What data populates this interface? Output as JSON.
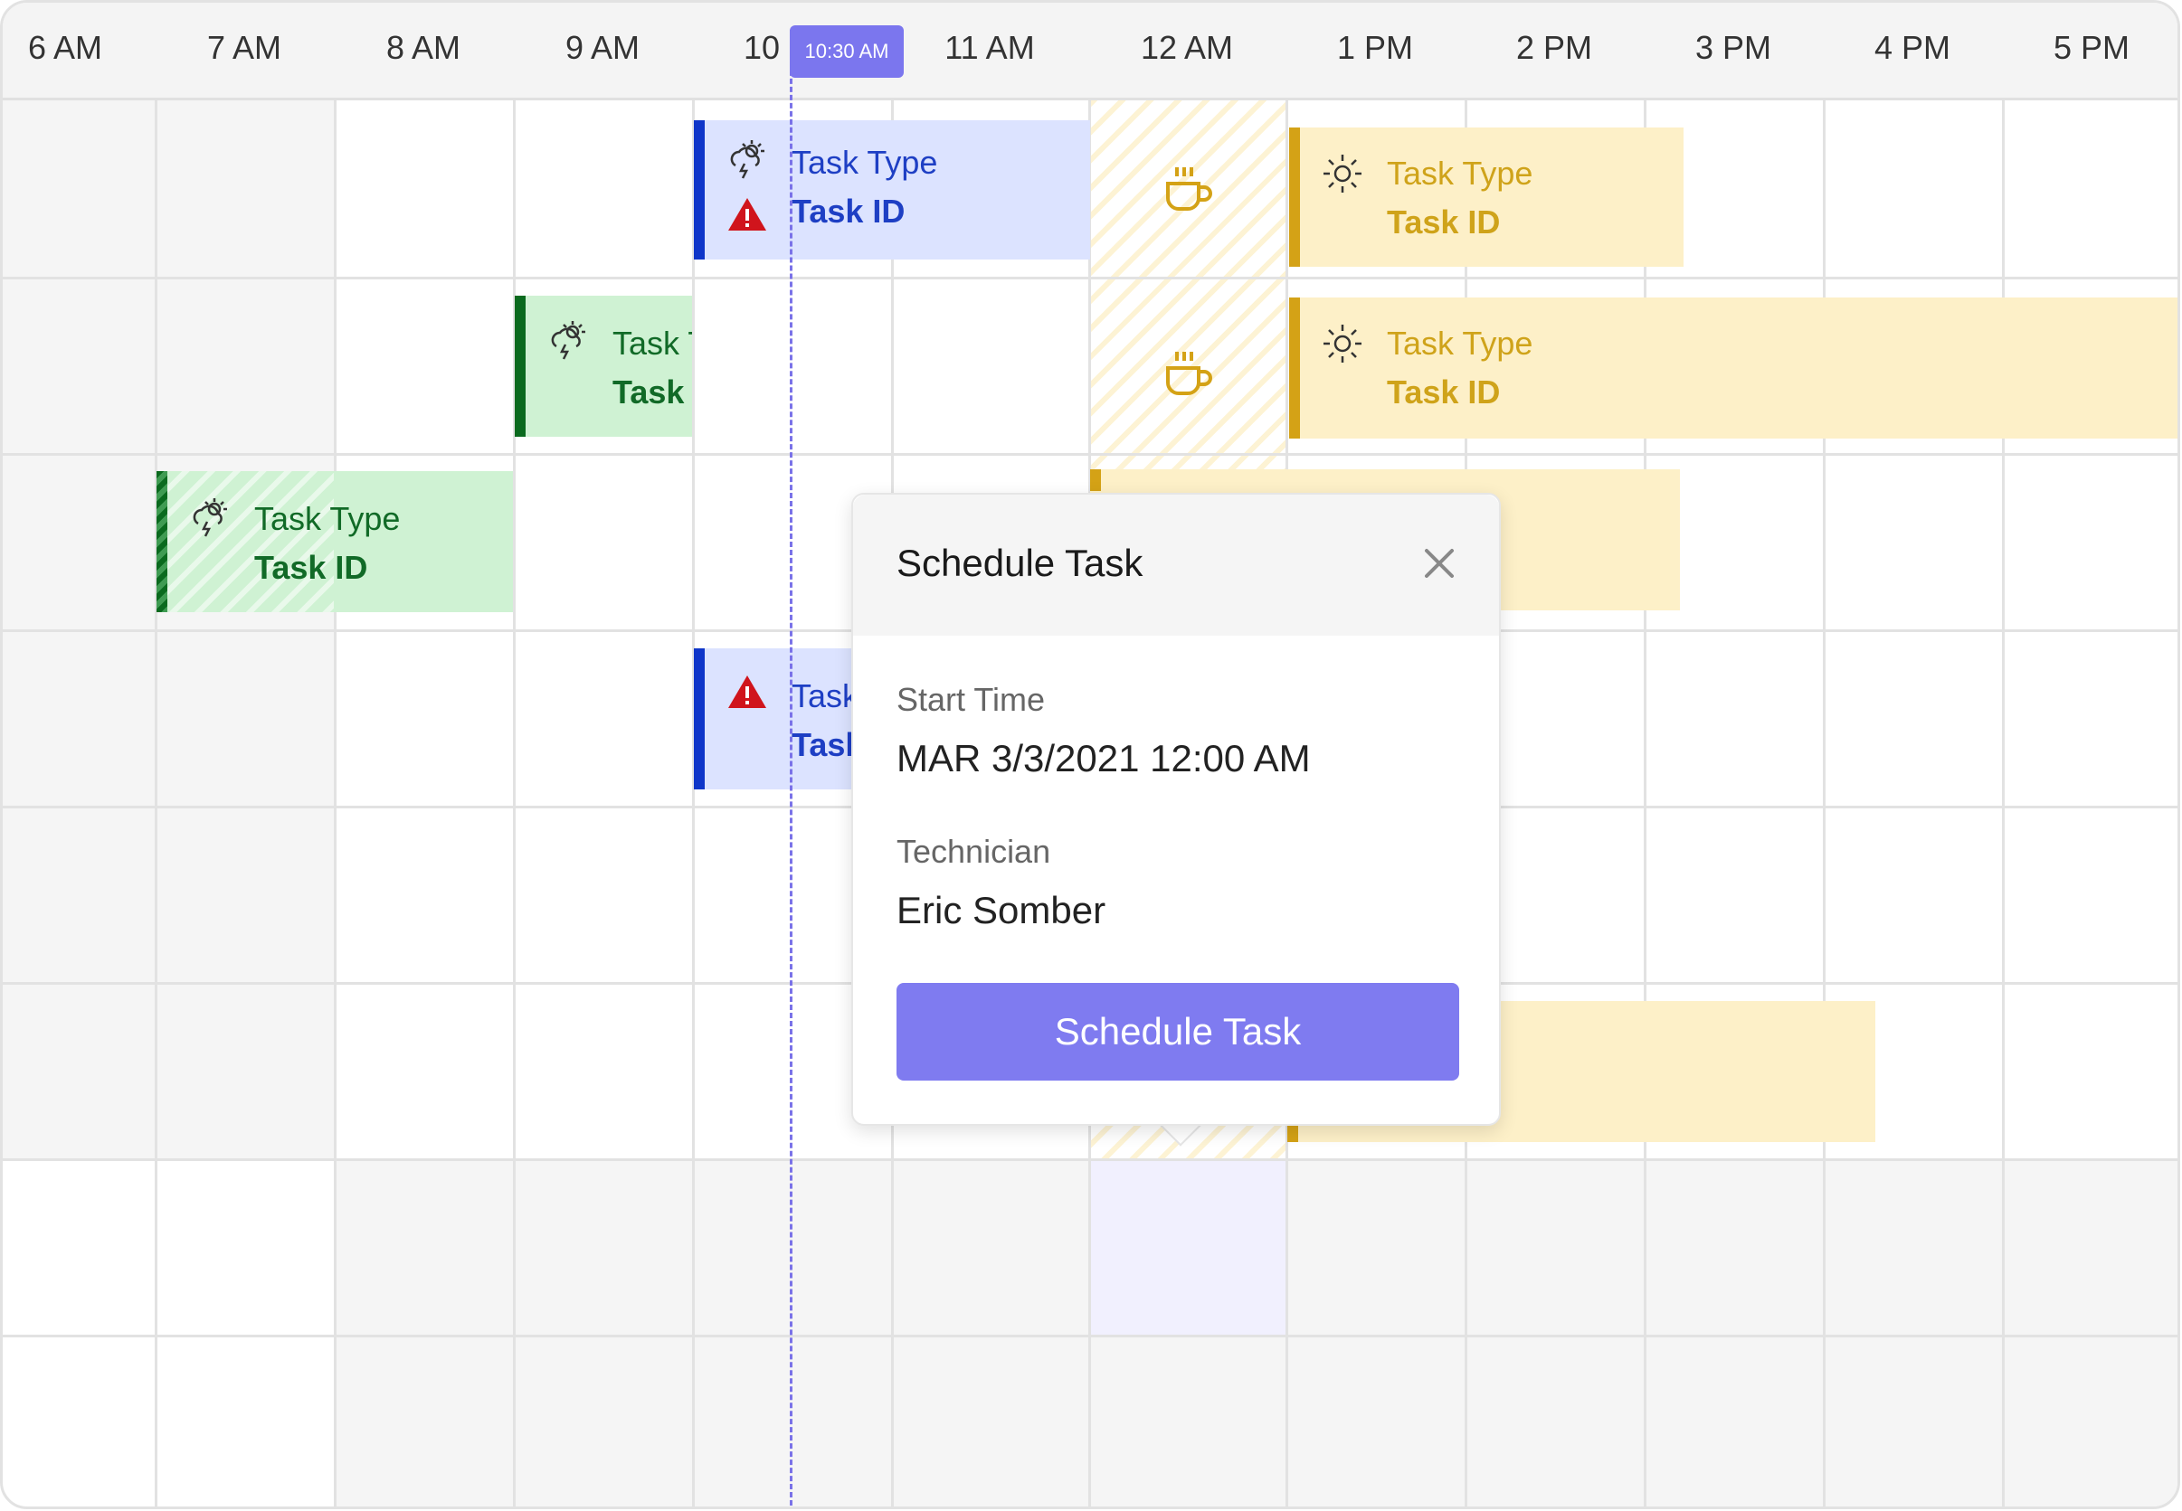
{
  "timeline": {
    "hours": [
      "6 AM",
      "7 AM",
      "8 AM",
      "9 AM",
      "10",
      "11 AM",
      "12 AM",
      "1 PM",
      "2 PM",
      "3 PM",
      "4 PM",
      "5 PM"
    ],
    "current_time_badge": "10:30 AM"
  },
  "tasks": [
    {
      "type_label": "Task Type",
      "id_label": "Task ID",
      "color": "blue",
      "icon": "storm-icon",
      "alert": true
    },
    {
      "type_label": "Task Type",
      "id_label": "Task ID",
      "color": "yellow",
      "icon": "sun-icon",
      "alert": false
    },
    {
      "type_label": "Task Type",
      "id_label": "Task",
      "color": "green",
      "icon": "storm-icon",
      "alert": false
    },
    {
      "type_label": "Task Type",
      "id_label": "Task ID",
      "color": "yellow",
      "icon": "sun-icon",
      "alert": false
    },
    {
      "type_label": "Task Type",
      "id_label": "Task ID",
      "color": "green",
      "icon": "storm-icon",
      "alert": false
    },
    {
      "type_label": "Task",
      "id_label": "Task",
      "color": "blue",
      "icon": "warning-icon",
      "alert": true
    }
  ],
  "popup": {
    "title": "Schedule Task",
    "start_time_label": "Start Time",
    "start_time_value": "MAR 3/3/2021 12:00 AM",
    "technician_label": "Technician",
    "technician_value": "Eric Somber",
    "button_label": "Schedule Task"
  },
  "colors": {
    "accent": "#7f7bf0",
    "blue_bar": "#0f36c9",
    "green_bar": "#0a6a1e",
    "yellow_bar": "#d4a216",
    "alert": "#d0141c"
  }
}
